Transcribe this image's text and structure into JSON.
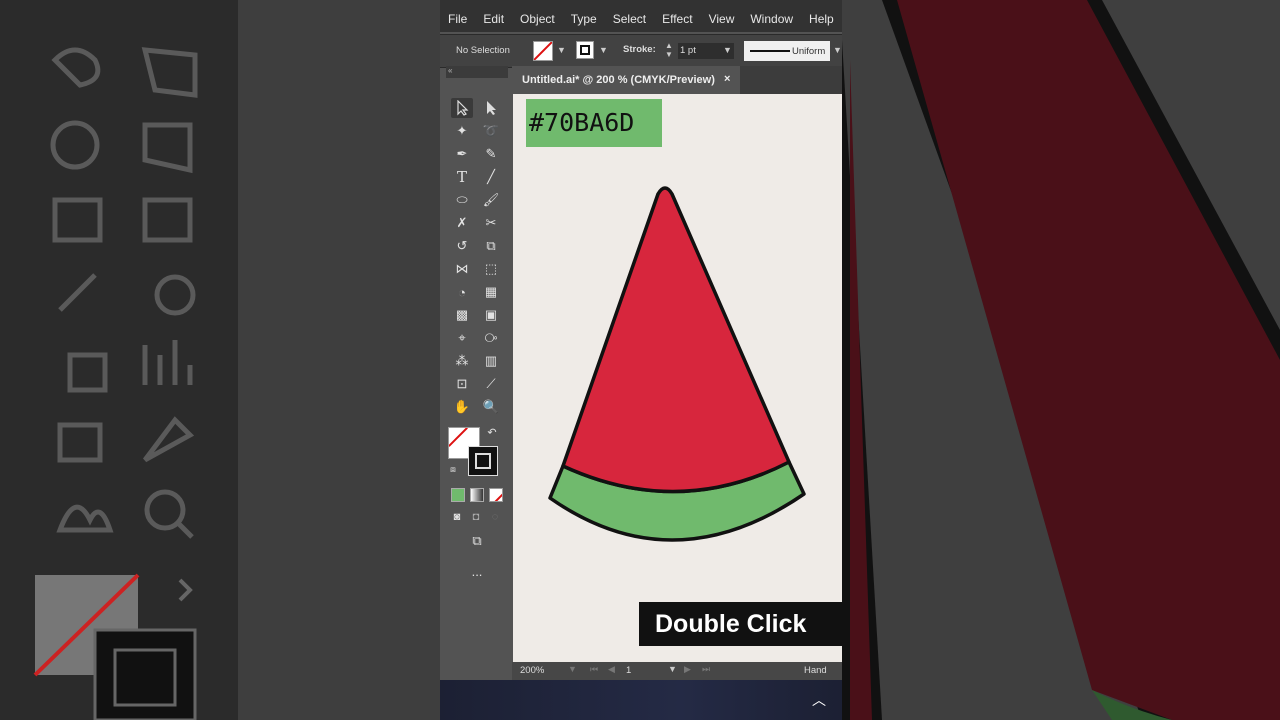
{
  "menu": [
    "File",
    "Edit",
    "Object",
    "Type",
    "Select",
    "Effect",
    "View",
    "Window",
    "Help"
  ],
  "control_bar": {
    "selection": "No Selection",
    "stroke_label": "Stroke:",
    "stroke_weight": "1 pt",
    "profile": "Uniform"
  },
  "document_tab": {
    "title": "Untitled.ai* @ 200 % (CMYK/Preview)",
    "close": "×"
  },
  "artboard": {
    "color_label": "#70BA6D",
    "caption": "Double Click"
  },
  "status_bar": {
    "zoom": "200%",
    "page": "1",
    "tool": "Hand"
  },
  "tool_panel": {
    "collapse": "«",
    "more": "..."
  },
  "colors": {
    "watermelon_green": "#70BA6D",
    "watermelon_red": "#D7263D",
    "outline": "#111111"
  }
}
